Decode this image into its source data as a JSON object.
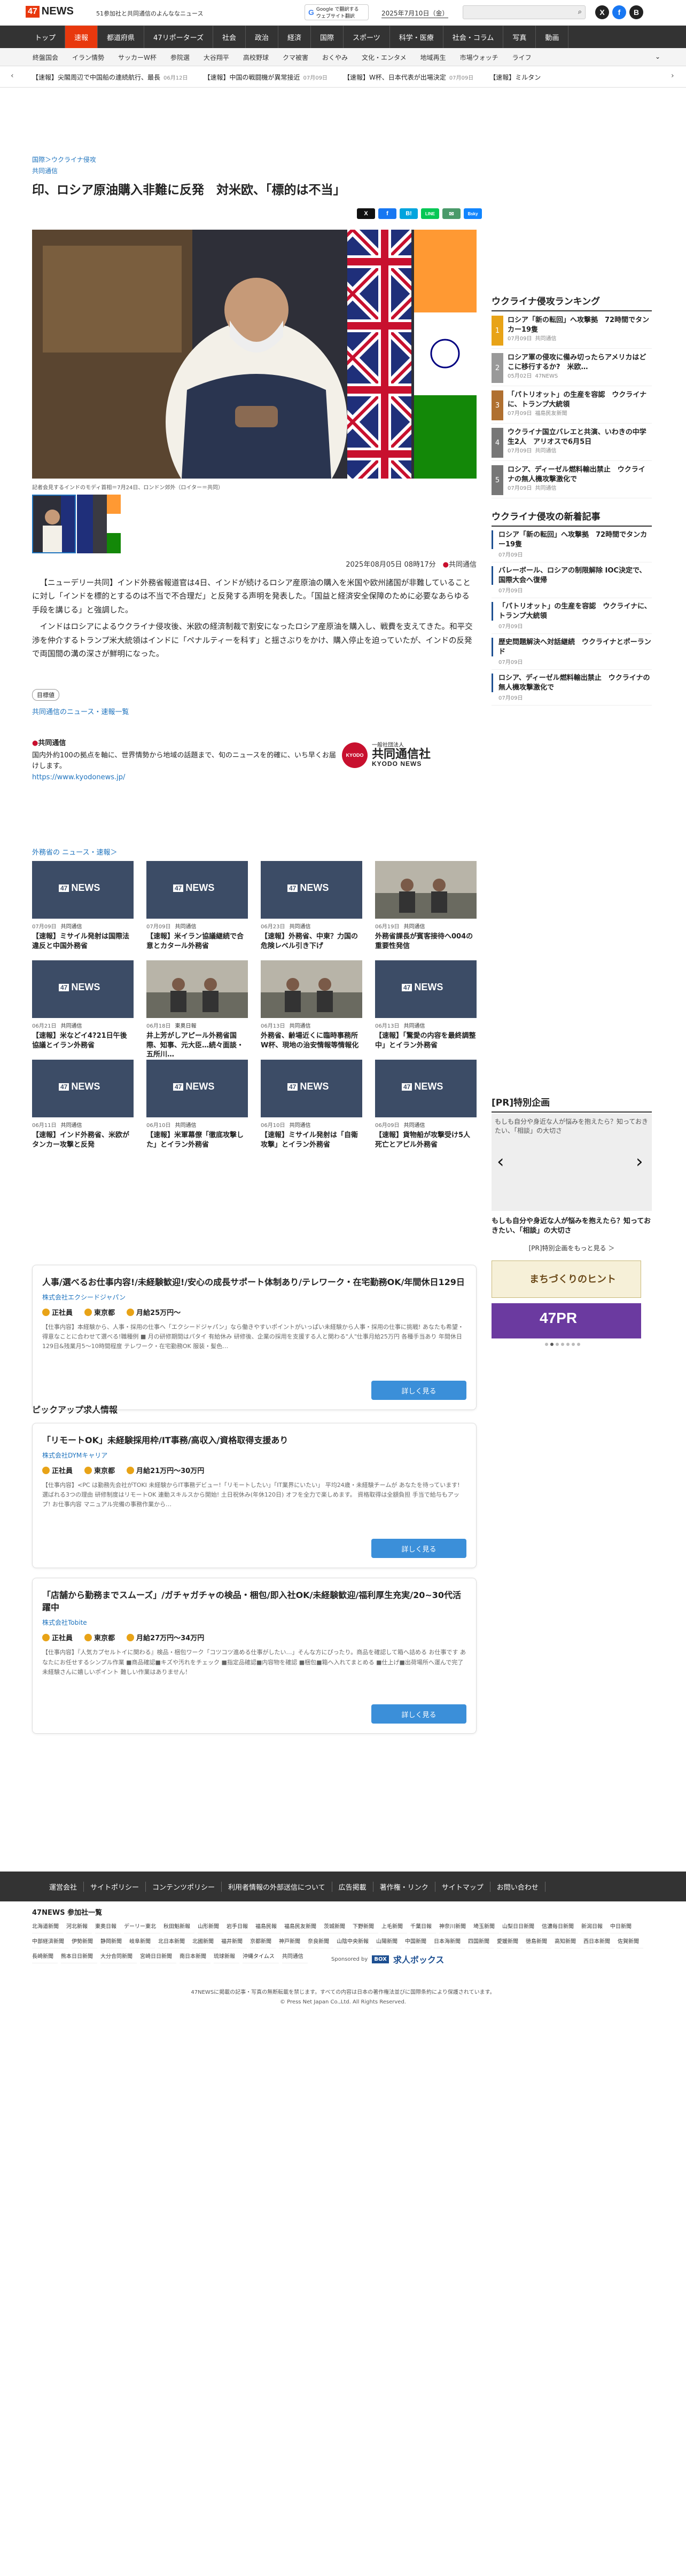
{
  "header": {
    "logo_num": "47",
    "logo_text": "NEWS",
    "tagline": "51参加社と共同通信のよんななニュース",
    "translate_top": "Google で翻訳する",
    "translate_bottom": "ウェブサイト翻訳",
    "date": "2025年7月10日（金）",
    "search_placeholder": ""
  },
  "nav_main": [
    "トップ",
    "速報",
    "都道府県",
    "47リポーターズ",
    "社会",
    "政治",
    "経済",
    "国際",
    "スポーツ",
    "科学・医療",
    "社会・コラム",
    "写真",
    "動画"
  ],
  "nav_sub": [
    "終盤国会",
    "イラン情勢",
    "サッカーW杯",
    "参院選",
    "大谷翔平",
    "高校野球",
    "クマ被害",
    "おくやみ",
    "文化・エンタメ",
    "地域再生",
    "市場ウォッチ",
    "ライフ"
  ],
  "ticker": [
    {
      "t": "【速報】尖閣周辺で中国船の連続航行、最長",
      "d": "06月12日"
    },
    {
      "t": "【速報】中国の戦闘機が異常接近",
      "d": "07月09日"
    },
    {
      "t": "【速報】W杯、日本代表が出場決定",
      "d": "07月09日"
    },
    {
      "t": "【速報】ミルタン",
      "d": ""
    }
  ],
  "article": {
    "breadcrumb": "国際＞ウクライナ侵攻",
    "source": "共同通信",
    "title": "印、ロシア原油購入非難に反発　対米欧、「標的は不当」",
    "share": [
      "X",
      "f",
      "B!",
      "LINE",
      "✉",
      "Bsky"
    ],
    "caption": "記者会見するインドのモディ首相＝7月24日、ロンドン郊外（ロイター＝共同）",
    "published": "2025年08月05日 08時17分",
    "pub_source": "共同通信",
    "paragraphs": [
      "【ニューデリー共同】インド外務省報道官は4日、インドが続けるロシア産原油の購入を米国や欧州諸国が非難していることに対し「インドを標的とするのは不当で不合理だ」と反発する声明を発表した。「国益と経済安全保障のために必要なあらゆる手段を講じる」と強調した。",
      "インドはロシアによるウクライナ侵攻後、米欧の経済制裁で割安になったロシア産原油を購入し、戦費を支えてきた。和平交渉を仲介するトランプ米大統領はインドに「ペナルティーを科す」と揺さぶりをかけ、購入停止を迫っていたが、インドの反発で両国間の溝の深さが鮮明になった。"
    ],
    "tag": "目標値",
    "more_link": "共同通信のニュース・速報一覧"
  },
  "kyodo": {
    "heading": "共同通信",
    "text": "国内外約100の拠点を軸に、世界情勢から地域の話題まで、旬のニュースを的確に、いち早くお届けします。",
    "url": "https://www.kyodonews.jp/",
    "logo_small": "一般社団法人",
    "logo_name": "共同通信社",
    "logo_en": "KYODO NEWS"
  },
  "related": {
    "heading": "外務省の ニュース・速報＞",
    "cards": [
      {
        "date": "07月09日",
        "src": "共同通信",
        "title": "【速報】ミサイル発射は国際法違反と中国外務省"
      },
      {
        "date": "07月09日",
        "src": "共同通信",
        "title": "【速報】米イラン協議継続で合意とカタール外務省"
      },
      {
        "date": "06月23日",
        "src": "共同通信",
        "title": "【速報】外務省、中東？力国の危険レベル引き下げ"
      },
      {
        "date": "06月19日",
        "src": "共同通信",
        "title": "外務省課長が賓客接待へ004の重要性発信"
      },
      {
        "date": "06月21日",
        "src": "共同通信",
        "title": "【速報】米などイ4?21日午後協議とイラン外務省"
      },
      {
        "date": "06月18日",
        "src": "東奥日報",
        "title": "井上芳がしアピール外務省国際、知事、元大臣…続々面談・五所川…"
      },
      {
        "date": "06月13日",
        "src": "共同通信",
        "title": "外務省、齢場近くに臨時事務所 W杯、現地の治安情報等情報化"
      },
      {
        "date": "06月13日",
        "src": "共同通信",
        "title": "【速報】「驚愛の内容を最終調整中」とイラン外務省"
      },
      {
        "date": "06月11日",
        "src": "共同通信",
        "title": "【速報】インド外務省、米欧がタンカー攻撃と反発"
      },
      {
        "date": "06月10日",
        "src": "共同通信",
        "title": "【速報】米軍幕僚「徹底攻撃した」とイラン外務省"
      },
      {
        "date": "06月10日",
        "src": "共同通信",
        "title": "【速報】ミサイル発射は「自衛攻撃」とイラン外務省"
      },
      {
        "date": "06月09日",
        "src": "共同通信",
        "title": "【速報】貨物船が攻撃受け5人死亡とアピル外務省"
      }
    ]
  },
  "jobs": {
    "heading": "ピックアップ求人情報",
    "items": [
      {
        "title": "人事/選べるお仕事内容!/未経験歓迎!/安心の成長サポート体制あり/テレワーク・在宅勤務OK/年間休日129日",
        "company": "株式会社エクシードジャパン",
        "type": "正社員",
        "place": "東京都",
        "salary": "月給25万円〜",
        "desc": "【仕事内容】本経験から、人事・採用の仕事へ「エクシードジャパン」なら働きやすいポイントがいっぱい未経験から人事・採用の仕事に挑戦! あなたも希望・得意なことに合わせて選べる!職種例 ■ 月の研修期間はパタイ 有給休み 研修後、企業の採用を支援する人と関わる\"人\"仕事月給25万円 各種手当あり 年間休日129日&残業月5〜10時間程度 テレワーク・在宅勤務OK 服装・髪色…",
        "button": "詳しく見る"
      },
      {
        "title": "「リモートOK」未経験採用枠/IT事務/高収入/資格取得支援あり",
        "company": "株式会社DYMキャリア",
        "type": "正社員",
        "place": "東京都",
        "salary": "月給21万円〜30万円",
        "desc": "【仕事内容】<PC は勤務先会社がTOKI 未経験からIT事務デビュー!「リモートしたい」「IT業界にいたい」 平均24歳・未経験チームが あなたを待っています! 選ばれる3つの理由 研修制度はリモートOK 連動スキルスから開始! 土日祝休み(年休120日) オフを全力で楽しめます。 資格取得は全額負担 手当で給与もアップ! お仕事内容 マニュアル完備の事務作業から…",
        "button": "詳しく見る"
      },
      {
        "title": "「店舗から勤務までスムーズ」/ガチャガチャの検品・梱包/即入社OK/未経験歓迎/福利厚生充実/20~30代活躍中",
        "company": "株式会社Tobite",
        "type": "正社員",
        "place": "東京都",
        "salary": "月給27万円〜34万円",
        "desc": "【仕事内容】『人気カプセルトイに関わる』検品・梱包ワーク「コツコツ進める仕事がしたい…」そんな方にぴったり。商品を確認して箱へ詰める お仕事です あなたにお任せするシンプル作業 ■商品確認■キズや汚れをチェック ■指定品確認■内容物を確認 ■梱包■箱へ入れてまとめる ■仕上げ■出荷場所へ運んで完了 未経験さんに嬉しいポイント 難しい作業はありません！",
        "button": "詳しく見る"
      }
    ],
    "sponsored": "Sponsored by",
    "sponsor_name": "求人ボックス"
  },
  "sidebar": {
    "ranking_title": "ウクライナ侵攻ランキング",
    "ranking": [
      {
        "n": "1",
        "t": "ロシア「新の転回」へ攻撃拠　72時間でタンカー19隻",
        "d": "07月09日",
        "s": "共同通信"
      },
      {
        "n": "2",
        "t": "ロシア軍の侵攻に備み切ったらアメリカはどこに移行するか?　米欧…",
        "d": "05月02日",
        "s": "47NEWS"
      },
      {
        "n": "3",
        "t": "「パトリオット」の生産を容認　ウクライナに、トランプ大統領",
        "d": "07月09日",
        "s": "福島民友新聞"
      },
      {
        "n": "4",
        "t": "ウクライナ国立バレエと共演、いわきの中学生2人　アリオスで6月5日",
        "d": "07月09日",
        "s": "共同通信"
      },
      {
        "n": "5",
        "t": "ロシア、ディーゼル燃料輸出禁止　ウクライナの無人機攻撃激化で",
        "d": "07月09日",
        "s": "共同通信"
      }
    ],
    "latest_title": "ウクライナ侵攻の新着記事",
    "latest": [
      {
        "t": "ロシア「新の転回」へ攻撃拠　72時間でタンカー19隻",
        "d": "07月09日"
      },
      {
        "t": "バレーボール、ロシアの制限解除 IOC決定で、国際大会へ復帰",
        "d": "07月09日"
      },
      {
        "t": "「パトリオット」の生産を容認　ウクライナに、トランプ大統領",
        "d": "07月09日"
      },
      {
        "t": "歴史問題解決へ対話継続　ウクライナとポーランド",
        "d": "07月09日"
      },
      {
        "t": "ロシア、ディーゼル燃料輸出禁止　ウクライナの無人機攻撃激化で",
        "d": "07月09日"
      }
    ],
    "pr_title": "[PR]特別企画",
    "pr_alt": "もしも自分や身近な人が悩みを抱えたら？知っておきたい、「相談」の大切さ",
    "pr_text": "もしも自分や身近な人が悩みを抱えたら？知っておきたい、「相談」の大切さ",
    "pr_more": "[PR]特別企画をもっと見る ＞",
    "banner1": "まちづくりのヒント",
    "banner2": "47PR"
  },
  "footer": {
    "nav": [
      "運営会社",
      "サイトポリシー",
      "コンテンツポリシー",
      "利用者情報の外部送信について",
      "広告掲載",
      "著作権・リンク",
      "サイトマップ",
      "お問い合わせ"
    ],
    "members_title": "47NEWS 参加社一覧",
    "members": [
      "北海道新聞",
      "河北新報",
      "東奥日報",
      "デーリー東北",
      "秋田魁新報",
      "山形新聞",
      "岩手日報",
      "福島民報",
      "福島民友新聞",
      "茨城新聞",
      "下野新聞",
      "上毛新聞",
      "千葉日報",
      "神奈川新聞",
      "埼玉新聞",
      "山梨日日新聞",
      "信濃毎日新聞",
      "新潟日報",
      "中日新聞",
      "中部経済新聞",
      "伊勢新聞",
      "静岡新聞",
      "岐阜新聞",
      "北日本新聞",
      "北國新聞",
      "福井新聞",
      "京都新聞",
      "神戸新聞",
      "奈良新聞",
      "山陰中央新報",
      "山陽新聞",
      "中国新聞",
      "日本海新聞",
      "四国新聞",
      "愛媛新聞",
      "徳島新聞",
      "高知新聞",
      "西日本新聞",
      "佐賀新聞",
      "長崎新聞",
      "熊本日日新聞",
      "大分合同新聞",
      "宮崎日日新聞",
      "南日本新聞",
      "琉球新報",
      "沖縄タイムス",
      "共同通信"
    ],
    "c1": "47NEWSに掲載の記事・写真の無断転載を禁じます。すべての内容は日本の著作権法並びに国際条約により保護されています。",
    "c2": "© Press Net Japan Co.,Ltd. All Rights Reserved."
  },
  "colors": {
    "accent": "#e8380d",
    "link": "#1e73be",
    "dark": "#333333"
  }
}
